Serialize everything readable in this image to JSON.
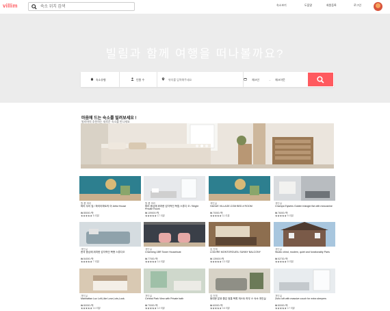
{
  "header": {
    "logo": "villim",
    "search_placeholder": "숙소 위치 검색",
    "nav": [
      "숙소보기",
      "도움말",
      "회원등록",
      "로그인"
    ]
  },
  "hero": {
    "title": "빌림과 함께 여행을 떠나볼까요?",
    "fields": {
      "type": "숙소유형",
      "guests": "인원 수",
      "location": "위치를 입력해주세요",
      "checkin": "체크인",
      "arrow": "→",
      "checkout": "체크아웃"
    }
  },
  "section": {
    "title": "마음에 드는 숙소를 빌려보세요 !",
    "subtitle": "빌리머의 추천하는 새로운 숙소를 만나세요"
  },
  "listings": [
    {
      "tag": "원 룸 파리",
      "name": "파리 우리 집 / 파리아파트의 아 Artist House",
      "price": "₩ 85000 /박",
      "rating": "★★★★★ 5 리뷰"
    },
    {
      "tag": "원 룸 파리",
      "name": "파리 중심에 위치한 감각적인 독립 스튜디 오 / Bright Private Room",
      "price": "₩ 109000 /박",
      "rating": "★★★★★ 17 리뷰"
    },
    {
      "tag": "개인실",
      "name": "HAGUE VILLAGE.COM BED # ROOM",
      "price": "₩ 70000 /박",
      "rating": "★★★★★ 11 리뷰"
    },
    {
      "tag": "개인실",
      "name": "Champs Elysées Golden triangle flat with mezzanine",
      "price": "₩ 76000 /박",
      "rating": "★★★★★ 9 리뷰"
    },
    {
      "tag": "개인실",
      "name": "한국 중심에 위치한 감각적인 복층 스튜디오",
      "price": "₩ 84000 /박",
      "rating": "★★★★★ 7 리뷰"
    },
    {
      "tag": "개인실",
      "name": "Charming 1BR Tower Houseboat",
      "price": "₩ 77000 /박",
      "rating": "★★★★★ 14 리뷰"
    },
    {
      "tag": "집 전체",
      "name": "LOUVRE MONTORGUEIL SUNNY BALCONY",
      "price": "₩ 139000 /박",
      "rating": "★★★★★ 13 리뷰"
    },
    {
      "tag": "개인실",
      "name": "Studio chind, modern, quiet and functionality Paris",
      "price": "₩ 52730 /박",
      "rating": "★★★★★ 8 리뷰"
    },
    {
      "tag": "개인실",
      "name": "Manhattan Luz Loft,Like Love,Lots,Look.",
      "price": "₩ 80000 /박",
      "rating": "★★★★★ 14 리뷰"
    },
    {
      "tag": "개인실",
      "name": "Central Park View with Private bath",
      "price": "₩ 70000 /박",
      "rating": "★★★★★ 12 리뷰"
    },
    {
      "tag": "집 전체",
      "name": "동대문 분위 좋은 정통 복록 게스트 하우 스 숙소 개인실",
      "price": "₩ 60000 /박",
      "rating": "★★★★★ 16 리뷰"
    },
    {
      "tag": "개인실",
      "name": "Zuho loft with massive couch for extra sleepers",
      "price": "₩ 80000 /박",
      "rating": "★★★★★ 17 리뷰"
    }
  ],
  "colors": {
    "accent": "#ff5a5f",
    "hero_bg": "#ececec",
    "stars": "#1a9c8f"
  }
}
